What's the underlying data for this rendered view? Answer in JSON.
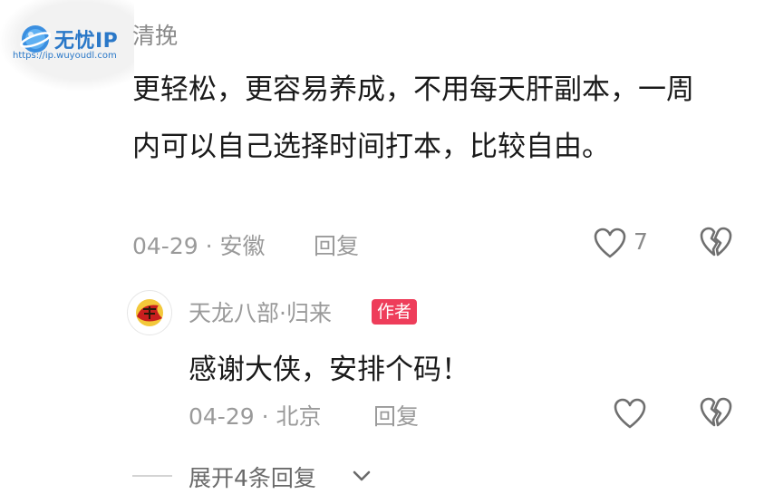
{
  "watermark": {
    "name": "无忧IP",
    "url": "https://ip.wuyoudl.com"
  },
  "comment": {
    "username": "清挽",
    "text": "更轻松，更容易养成，不用每天肝副本，一周内可以自己选择时间打本，比较自由。",
    "date_location": "04-29 · 安徽",
    "reply_label": "回复",
    "like_count": "7",
    "icons": {
      "like": "heart-outline-icon",
      "dislike": "broken-heart-icon"
    }
  },
  "reply": {
    "username": "天龙八部·归来",
    "author_badge": "作者",
    "text": "感谢大侠，安排个码！",
    "date_location": "04-29 · 北京",
    "reply_label": "回复",
    "icons": {
      "like": "heart-outline-icon",
      "dislike": "broken-heart-icon"
    }
  },
  "expand": {
    "label": "展开4条回复",
    "icon": "chevron-down-icon"
  },
  "colors": {
    "author_badge": "#ee3d5a",
    "meta_text": "#9a9a9a",
    "watermark": "#2a78c8"
  }
}
